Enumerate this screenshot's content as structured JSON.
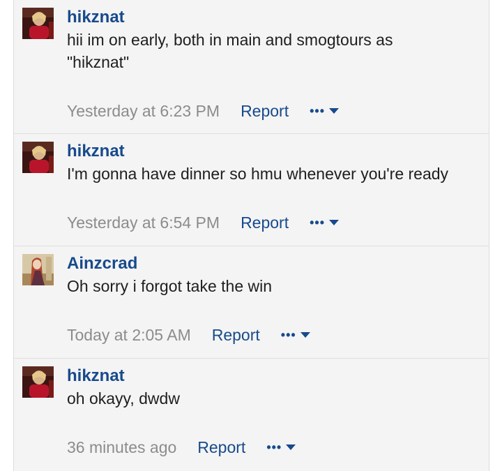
{
  "colors": {
    "author": "#174a8c",
    "link": "#174a8c",
    "timestamp": "#8c8c8c",
    "background": "#f4f4f4",
    "text": "#1e1e1e"
  },
  "comments": [
    {
      "author": "hikznat",
      "avatar": "hikznat-avatar",
      "text": "hii im on early, both in main and smogtours as\n\"hikznat\"",
      "time": "Yesterday at 6:23 PM",
      "report": "Report",
      "more": "•••"
    },
    {
      "author": "hikznat",
      "avatar": "hikznat-avatar",
      "text": "I'm gonna have dinner so hmu whenever you're ready",
      "time": "Yesterday at 6:54 PM",
      "report": "Report",
      "more": "•••"
    },
    {
      "author": "Ainzcrad",
      "avatar": "ainzcrad-avatar",
      "text": "Oh sorry i forgot take the win",
      "time": "Today at 2:05 AM",
      "report": "Report",
      "more": "•••"
    },
    {
      "author": "hikznat",
      "avatar": "hikznat-avatar",
      "text": "oh okayy, dwdw",
      "time": "36 minutes ago",
      "report": "Report",
      "more": "•••"
    }
  ]
}
